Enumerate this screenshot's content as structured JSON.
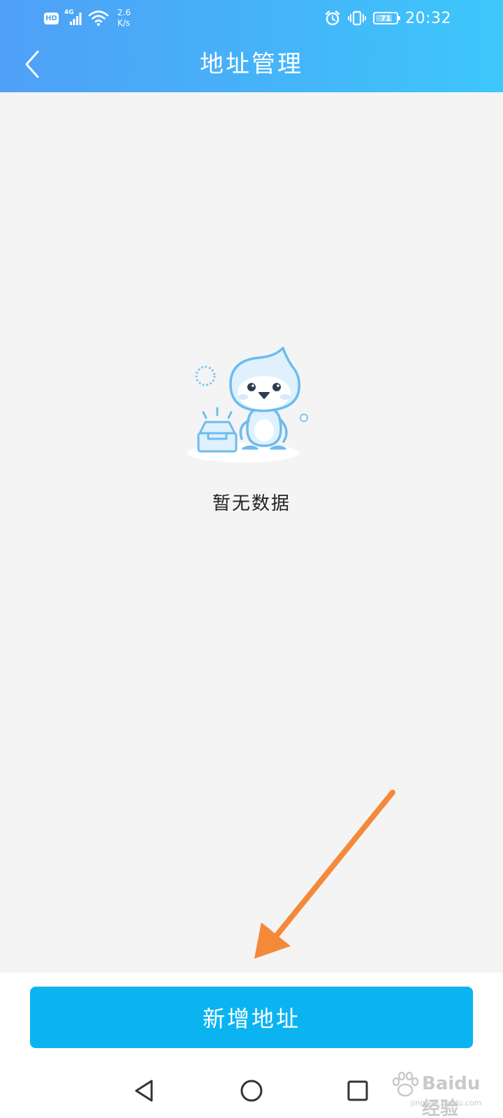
{
  "status_bar": {
    "hd_label": "HD",
    "network_type": "4G",
    "speed_value": "2.6",
    "speed_unit": "K/s",
    "battery_level": "71",
    "time": "20:32"
  },
  "nav": {
    "title": "地址管理"
  },
  "empty_state": {
    "message": "暂无数据"
  },
  "bottom": {
    "add_button_label": "新增地址"
  },
  "colors": {
    "header_start": "#4fa0f7",
    "header_end": "#3dc7fb",
    "primary_button": "#0bb4f1",
    "annotation_arrow": "#f5893a",
    "background": "#f4f4f4"
  },
  "icons": {
    "back": "chevron-left-icon",
    "sys_back": "triangle-back-icon",
    "sys_home": "circle-home-icon",
    "sys_recent": "square-recent-icon"
  },
  "watermark": {
    "brand": "Baidu 经验",
    "domain": "jingyan.baidu.com"
  }
}
